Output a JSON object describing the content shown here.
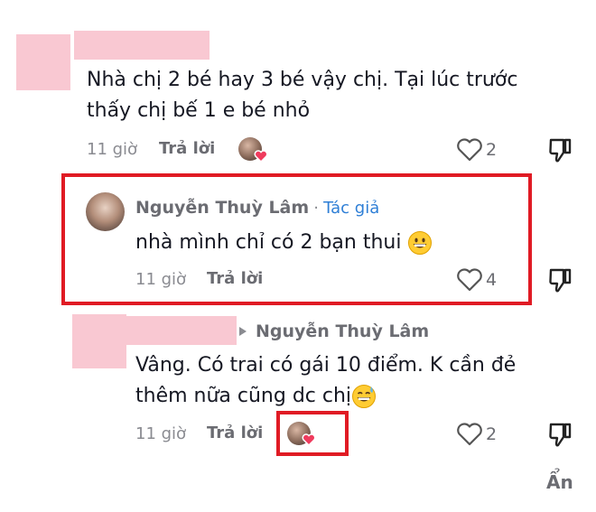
{
  "comments": [
    {
      "text": "Nhà chị 2 bé hay 3 bé vậy chị. Tại lúc trước thấy chị bế 1 e bé nhỏ",
      "time": "11 giờ",
      "reply_label": "Trả lời",
      "likes": "2"
    },
    {
      "author": "Nguyễn Thuỳ Lâm",
      "separator": "·",
      "author_tag": "Tác giả",
      "text": "nhà mình chỉ có 2 bạn thui",
      "time": "11 giờ",
      "reply_label": "Trả lời",
      "likes": "4"
    },
    {
      "reply_to": "Nguyễn Thuỳ Lâm",
      "text_line1": "Vâng. Có trai có gái 10 điểm. K cần đẻ",
      "text_line2": "thêm nữa cũng dc chị",
      "time": "11 giờ",
      "reply_label": "Trả lời",
      "likes": "2"
    }
  ],
  "hide_label": "Ẩn",
  "colors": {
    "highlight": "#e01b24",
    "redaction": "#f9c8d2",
    "author_tag": "#2f7fd6"
  },
  "icons": [
    "heart-outline-icon",
    "dislike-icon",
    "creator-liked-avatar-icon",
    "grinning-emoji-icon",
    "sweat-smile-emoji-icon",
    "reply-arrow-icon"
  ]
}
